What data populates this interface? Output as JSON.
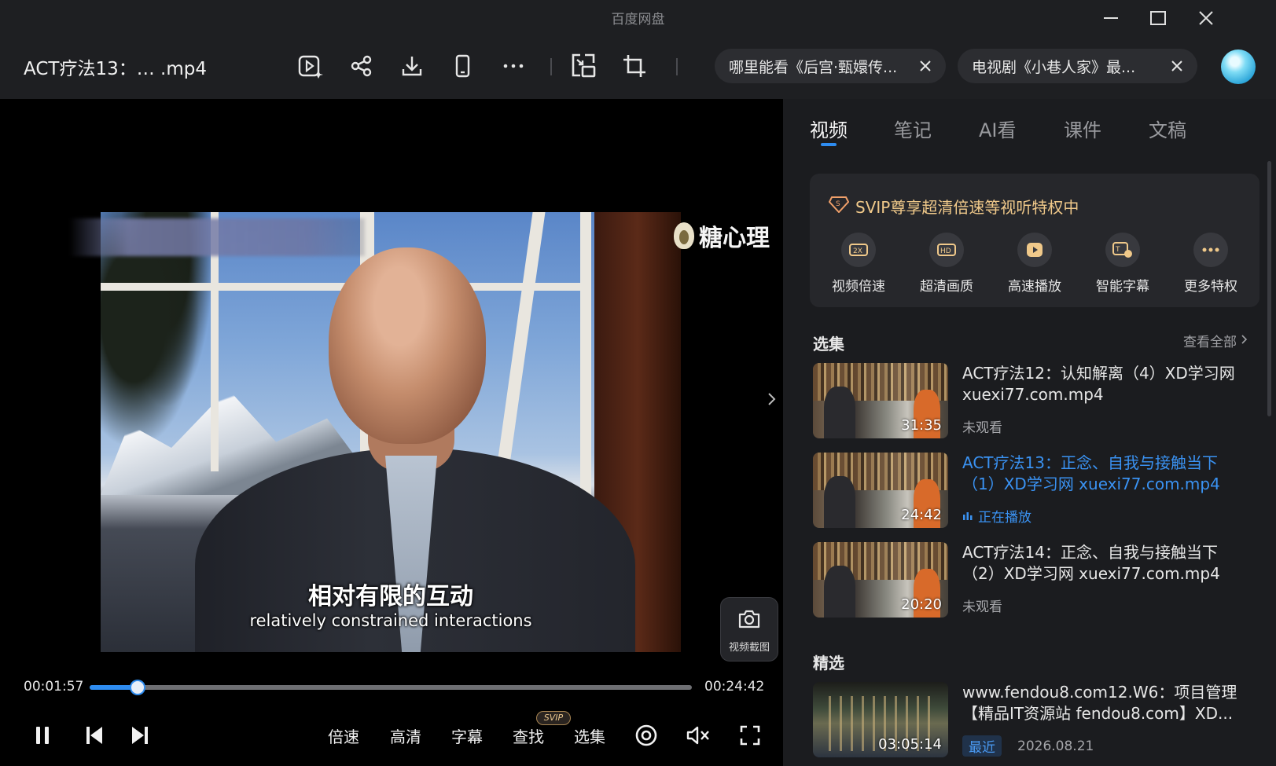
{
  "window": {
    "title": "百度网盘"
  },
  "toolbar": {
    "file_title": "ACT疗法13：…  .mp4",
    "open_tabs": [
      {
        "label": "哪里能看《后宫·甄嬛传..."
      },
      {
        "label": "电视剧《小巷人家》最..."
      }
    ]
  },
  "player": {
    "brand_watermark": "糖心理",
    "subtitle_zh": "相对有限的互动",
    "subtitle_en": "relatively constrained interactions",
    "screenshot_label": "视频截图",
    "current_time": "00:01:57",
    "total_time": "00:24:42",
    "progress": 0.079,
    "controls": {
      "speed": "倍速",
      "quality": "高清",
      "subtitles": "字幕",
      "find": "查找",
      "find_badge": "SVIP",
      "episodes": "选集"
    }
  },
  "side": {
    "tabs": [
      "视频",
      "笔记",
      "AI看",
      "课件",
      "文稿"
    ],
    "active_tab": 0,
    "svip": {
      "title": "SVIP尊享超清倍速等视听特权中",
      "perks": [
        {
          "label": "视频倍速",
          "icon": "speed-2x-icon"
        },
        {
          "label": "超清画质",
          "icon": "hd-icon"
        },
        {
          "label": "高速播放",
          "icon": "fast-play-icon"
        },
        {
          "label": "智能字幕",
          "icon": "ai-subtitle-icon"
        },
        {
          "label": "更多特权",
          "icon": "more-icon"
        }
      ]
    },
    "episodes_title": "选集",
    "view_all": "查看全部",
    "episodes": [
      {
        "title": "ACT疗法12：认知解离（4）XD学习网 xuexi77.com.mp4",
        "duration": "31:35",
        "status": "未观看"
      },
      {
        "title": "ACT疗法13：正念、自我与接触当下（1）XD学习网 xuexi77.com.mp4",
        "duration": "24:42",
        "status": "正在播放"
      },
      {
        "title": "ACT疗法14：正念、自我与接触当下（2）XD学习网 xuexi77.com.mp4",
        "duration": "20:20",
        "status": "未观看"
      }
    ],
    "picks_title": "精选",
    "picks": [
      {
        "title": "www.fendou8.com12.W6：项目管理【精品IT资源站 fendou8.com】XD...",
        "duration": "03:05:14",
        "badge": "最近",
        "date": "2026.08.21"
      }
    ]
  },
  "colors": {
    "accent": "#2e8cf0",
    "svip_gold": "#f0c98a",
    "background": "#1b1c1f"
  }
}
